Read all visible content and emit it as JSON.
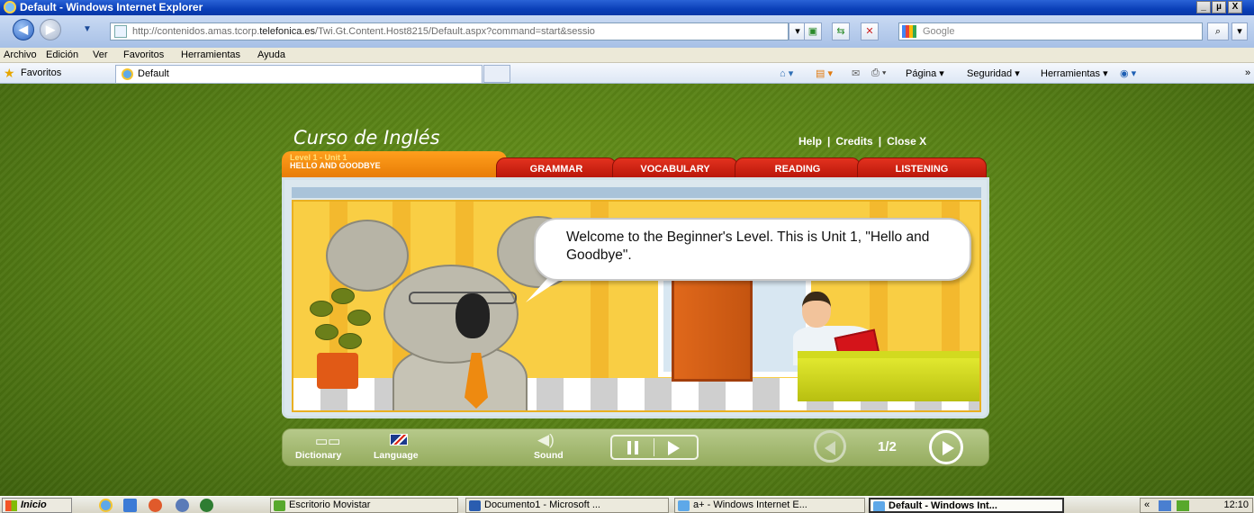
{
  "window": {
    "title": "Default - Windows Internet Explorer",
    "min": "_",
    "max": "µ",
    "close": "X"
  },
  "address": {
    "url_prefix": "http://contenidos.amas.tcorp.",
    "url_domain": "telefonica.es",
    "url_suffix": "/Twi.Gt.Content.Host8215/Default.aspx?command=start&sessio",
    "search_placeholder": "Google"
  },
  "menu": [
    "Archivo",
    "Edición",
    "Ver",
    "Favoritos",
    "Herramientas",
    "Ayuda"
  ],
  "favorites": {
    "label": "Favoritos",
    "tab_title": "Default",
    "commands": [
      "Página ▾",
      "Seguridad ▾",
      "Herramientas ▾"
    ]
  },
  "course": {
    "title": "Curso de Inglés",
    "links": [
      "Help",
      "Credits",
      "Close X"
    ],
    "separator": "|",
    "level_line1": "Level 1 - Unit 1",
    "level_line2": "HELLO AND GOODBYE",
    "tabs": [
      "GRAMMAR",
      "VOCABULARY",
      "READING",
      "LISTENING"
    ],
    "speech": "Welcome to the Beginner's Level. This is Unit 1, \"Hello and Goodbye\"."
  },
  "controls": {
    "dictionary": "Dictionary",
    "language": "Language",
    "sound": "Sound",
    "page_indicator": "1/2"
  },
  "taskbar": {
    "start": "Inicio",
    "tasks": [
      "Escritorio Movistar",
      "Documento1 - Microsoft ...",
      "a+ - Windows Internet E...",
      "Default - Windows Int..."
    ],
    "clock": "12:10"
  },
  "colors": {
    "content_green": "#5a8418",
    "tab_red": "#c91d0e",
    "tab_orange": "#f28a10",
    "scene_yellow": "#f9ce44"
  }
}
